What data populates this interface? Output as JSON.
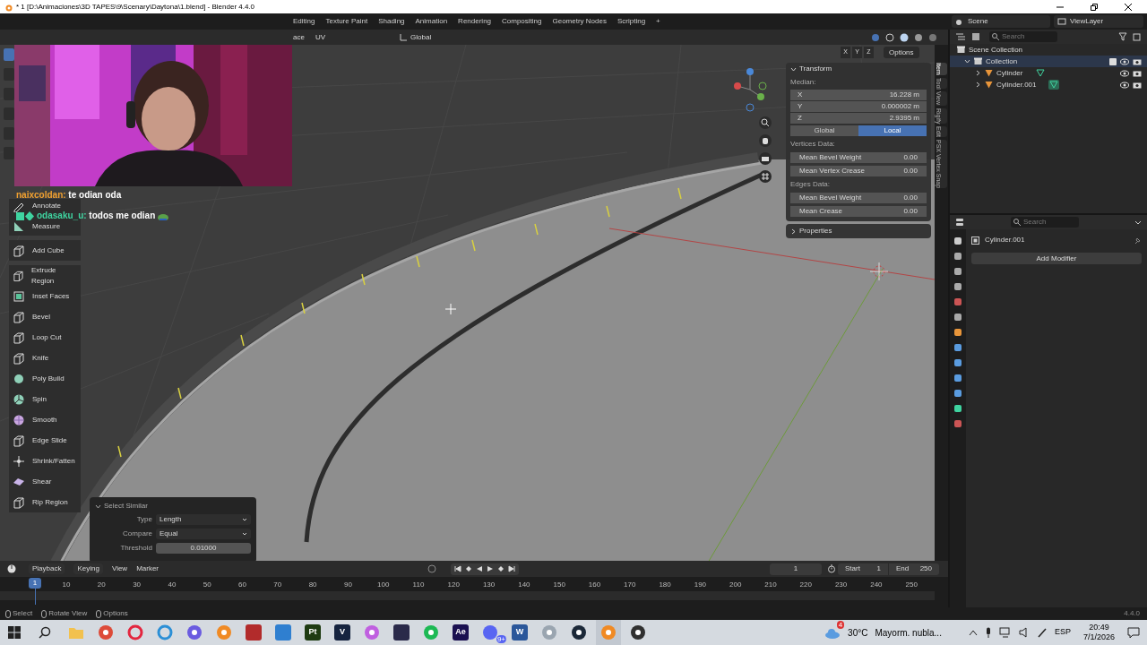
{
  "window": {
    "title": "* 1 [D:\\Animaciones\\3D TAPES\\9\\Scenary\\Daytona\\1.blend] - Blender 4.4.0"
  },
  "workspace_tabs": [
    "Editing",
    "Texture Paint",
    "Shading",
    "Animation",
    "Rendering",
    "Compositing",
    "Geometry Nodes",
    "Scripting",
    "+"
  ],
  "scene": "Scene",
  "view_layer": "ViewLayer",
  "viewport_header": {
    "menus": [
      "ace",
      "UV"
    ],
    "orientation": "Global",
    "options": "Options",
    "axes": [
      "X",
      "Y",
      "Z"
    ]
  },
  "chat": [
    {
      "user": "naixcoldan:",
      "message": "te odian oda",
      "color": "#f0a030",
      "badge": false
    },
    {
      "user": "odasaku_u:",
      "message": "todos me odian",
      "color": "#3fd4a0",
      "badge": true
    }
  ],
  "tool_groups": [
    [
      {
        "label": "Annotate",
        "kind": "annotate"
      },
      {
        "label": "Measure",
        "kind": "measure"
      }
    ],
    [
      {
        "label": "Add Cube",
        "kind": "cube"
      }
    ],
    [
      {
        "label": "Extrude Region",
        "kind": "cube"
      },
      {
        "label": "Inset Faces",
        "kind": "inset"
      },
      {
        "label": "Bevel",
        "kind": "cube"
      },
      {
        "label": "Loop Cut",
        "kind": "cube"
      },
      {
        "label": "Knife",
        "kind": "cube"
      },
      {
        "label": "Poly Build",
        "kind": "blob"
      },
      {
        "label": "Spin",
        "kind": "spin"
      },
      {
        "label": "Smooth",
        "kind": "sphere"
      },
      {
        "label": "Edge Slide",
        "kind": "cube"
      },
      {
        "label": "Shrink/Fatten",
        "kind": "arrows"
      },
      {
        "label": "Shear",
        "kind": "slab"
      },
      {
        "label": "Rip Region",
        "kind": "cube"
      }
    ]
  ],
  "select_similar": {
    "title": "Select Similar",
    "expanded": true,
    "fields": [
      {
        "label": "Type",
        "value": "Length",
        "kind": "dropdown"
      },
      {
        "label": "Compare",
        "value": "Equal",
        "kind": "dropdown"
      },
      {
        "label": "Threshold",
        "value": "0.01000",
        "kind": "number"
      }
    ]
  },
  "n_panel": {
    "transform": {
      "title": "Transform",
      "expanded": true,
      "median_label": "Median:",
      "coords": [
        {
          "axis": "X",
          "value": "16.228 m"
        },
        {
          "axis": "Y",
          "value": "0.000002 m"
        },
        {
          "axis": "Z",
          "value": "2.9395 m"
        }
      ],
      "space": [
        {
          "label": "Global",
          "selected": false
        },
        {
          "label": "Local",
          "selected": true
        }
      ],
      "vertices_label": "Vertices Data:",
      "vertex_fields": [
        {
          "label": "Mean Bevel Weight",
          "value": "0.00"
        },
        {
          "label": "Mean Vertex Crease",
          "value": "0.00"
        }
      ],
      "edges_label": "Edges Data:",
      "edge_fields": [
        {
          "label": "Mean Bevel Weight",
          "value": "0.00"
        },
        {
          "label": "Mean Crease",
          "value": "0.00"
        }
      ]
    },
    "properties": {
      "title": "Properties",
      "expanded": false
    },
    "tabs": [
      {
        "label": "Item",
        "selected": true
      },
      {
        "label": "Tool",
        "selected": false
      },
      {
        "label": "View",
        "selected": false
      },
      {
        "label": "Rigify",
        "selected": false
      },
      {
        "label": "Edit",
        "selected": false
      },
      {
        "label": "PSX Vertex Snap",
        "selected": false
      }
    ]
  },
  "outliner": {
    "search_placeholder": "Search",
    "root": "Scene Collection",
    "tree": [
      {
        "label": "Collection",
        "expanded": true,
        "checked": true,
        "children": [
          {
            "label": "Cylinder",
            "expanded": false,
            "active": false
          },
          {
            "label": "Cylinder.001",
            "expanded": false,
            "active": true
          }
        ]
      }
    ]
  },
  "properties_editor": {
    "search_placeholder": "Search",
    "object": "Cylinder.001",
    "add_modifier": "Add Modifier"
  },
  "timeline": {
    "menus": [
      "Playback",
      "Keying",
      "View",
      "Marker"
    ],
    "current_frame": "1",
    "start_label": "Start",
    "start": "1",
    "end_label": "End",
    "end": "250",
    "playhead": "1",
    "ticks": [
      "10",
      "20",
      "30",
      "40",
      "50",
      "60",
      "70",
      "80",
      "90",
      "100",
      "110",
      "120",
      "130",
      "140",
      "150",
      "160",
      "170",
      "180",
      "190",
      "200",
      "210",
      "220",
      "230",
      "240",
      "250"
    ]
  },
  "status_bar": {
    "hints": [
      "Select",
      "Rotate View",
      "Options"
    ],
    "version": "4.4.0"
  },
  "taskbar": {
    "apps": [
      {
        "kind": "folder",
        "color": "#f2c14e",
        "active": false
      },
      {
        "kind": "circle",
        "color": "#dd4b39",
        "active": false
      },
      {
        "kind": "ring",
        "color": "#e3263f",
        "active": false
      },
      {
        "kind": "ring",
        "color": "#2b8fd6",
        "active": false
      },
      {
        "kind": "circle",
        "color": "#6a5be0",
        "active": false
      },
      {
        "kind": "circle",
        "color": "#f08a24",
        "active": false
      },
      {
        "kind": "square",
        "color": "#b22b2b",
        "active": false
      },
      {
        "kind": "square",
        "color": "#2f7fd0",
        "active": false
      },
      {
        "kind": "square",
        "color": "#1e3b12",
        "label": "Pt",
        "active": false
      },
      {
        "kind": "square",
        "color": "#15233f",
        "label": "V",
        "active": false
      },
      {
        "kind": "circle",
        "color": "#c060e0",
        "active": false
      },
      {
        "kind": "square",
        "color": "#2a2a4a",
        "active": false
      },
      {
        "kind": "circle",
        "color": "#1db954",
        "active": false
      },
      {
        "kind": "square",
        "color": "#1a1050",
        "label": "Ae",
        "active": false
      },
      {
        "kind": "circle",
        "color": "#5865f2",
        "label": "9+",
        "active": false
      },
      {
        "kind": "square",
        "color": "#2b579a",
        "label": "W",
        "active": false
      },
      {
        "kind": "circle",
        "color": "#9aa5b0",
        "active": false
      },
      {
        "kind": "circle",
        "color": "#1b2838",
        "active": false
      },
      {
        "kind": "circle",
        "color": "#f08a24",
        "active": true
      },
      {
        "kind": "circle",
        "color": "#303030",
        "active": false
      }
    ],
    "weather": {
      "badge": "4",
      "temperature": "30°C",
      "condition": "Mayorm. nubla..."
    },
    "language": "ESP",
    "time": "20:49",
    "date": "7/1/2026"
  }
}
